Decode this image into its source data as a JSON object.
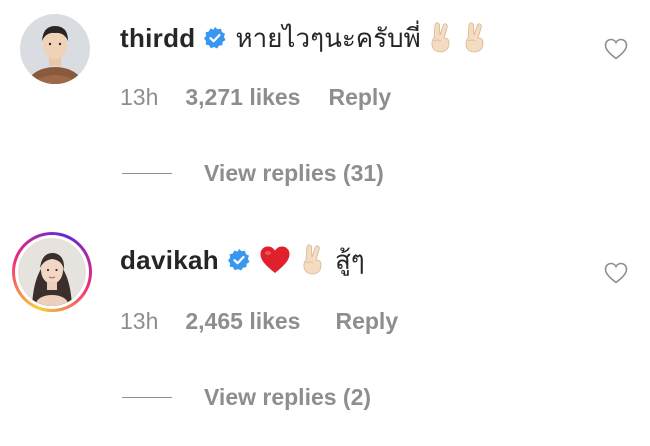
{
  "comments": [
    {
      "username": "thirdd",
      "verified": true,
      "text": "หายไวๆนะครับพี่",
      "emojis": [
        "victory-hand",
        "victory-hand"
      ],
      "time": "13h",
      "likes": "3,271 likes",
      "reply_label": "Reply",
      "view_replies": "View replies (31)",
      "liked": false
    },
    {
      "username": "davikah",
      "verified": true,
      "text": "สู้ๆ",
      "emojis": [
        "red-heart",
        "victory-hand"
      ],
      "time": "13h",
      "likes": "2,465 likes",
      "reply_label": "Reply",
      "view_replies": "View replies (2)",
      "liked": false,
      "has_story_ring": true
    }
  ],
  "colors": {
    "primary_text": "#262626",
    "secondary_text": "#8e8e8e",
    "verified_blue": "#3897f0",
    "heart_red": "#ed4956"
  }
}
